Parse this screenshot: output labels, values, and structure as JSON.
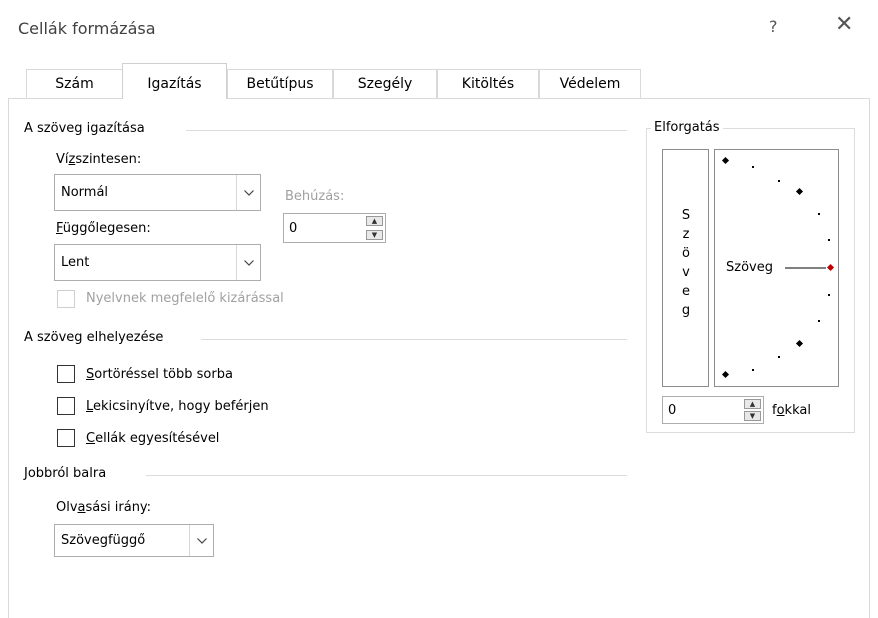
{
  "window": {
    "title": "Cellák formázása",
    "help_glyph": "?",
    "close_glyph": "✕"
  },
  "tabs": [
    {
      "label": "Szám"
    },
    {
      "label": "Igazítás"
    },
    {
      "label": "Betűtípus"
    },
    {
      "label": "Szegély"
    },
    {
      "label": "Kitöltés"
    },
    {
      "label": "Védelem"
    }
  ],
  "active_tab": "Igazítás",
  "alignment": {
    "section_title": "A szöveg igazítása",
    "horizontal": {
      "label_pre": "Ví",
      "label_key": "z",
      "label_post": "szintesen:",
      "value": "Normál"
    },
    "indent": {
      "label": "Behúzás:",
      "value": "0"
    },
    "vertical": {
      "label_key": "F",
      "label_post": "üggőlegesen:",
      "value": "Lent"
    },
    "justify_distributed": {
      "label": "Nyelvnek megfelelő kizárással",
      "checked": false,
      "enabled": false
    }
  },
  "text_control": {
    "section_title": "A szöveg elhelyezése",
    "wrap": {
      "label_key": "S",
      "label_post": "ortöréssel több sorba",
      "checked": false
    },
    "shrink": {
      "label_key": "L",
      "label_post": "ekicsinyítve, hogy beférjen",
      "checked": false
    },
    "merge": {
      "label_key": "C",
      "label_post": "ellák egyesítésével",
      "checked": false
    }
  },
  "rtl": {
    "section_title": "Jobbról balra",
    "direction": {
      "label_pre": "Olv",
      "label_key": "a",
      "label_post": "sási irány:",
      "value": "Szövegfüggő"
    }
  },
  "orientation": {
    "section_title": "Elforgatás",
    "vertical_text": [
      "S",
      "z",
      "ö",
      "v",
      "e",
      "g"
    ],
    "dial_text": "Szöveg",
    "degrees": {
      "value": "0",
      "label_pre": "f",
      "label_key": "o",
      "label_post": "kkal"
    },
    "marker_color": "#c00000"
  },
  "colors": {
    "accent": "#c00000"
  }
}
